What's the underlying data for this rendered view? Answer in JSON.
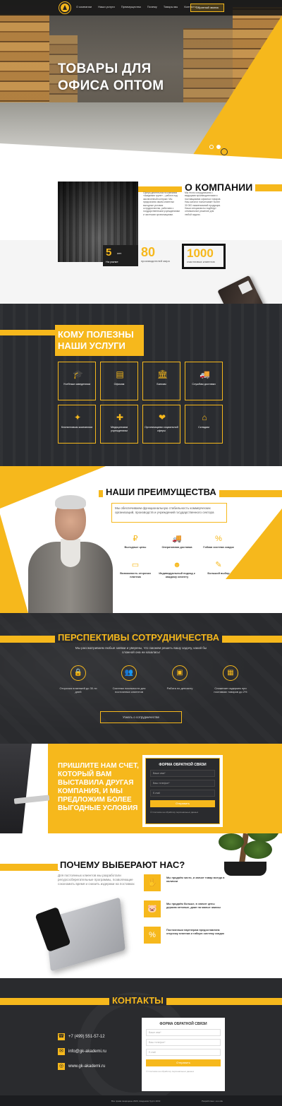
{
  "nav": {
    "items": [
      "О компании",
      "Наши услуги",
      "Преимущества",
      "Почему",
      "Товары мы",
      "Контакты"
    ],
    "cta": "Обратный звонок"
  },
  "hero": {
    "title_line1": "ТОВАРЫ ДЛЯ",
    "title_line2": "ОФИСА ОПТОМ"
  },
  "about": {
    "title": "О КОМПАНИИ",
    "col1": "Сфера деятельности компании «Академия групп» – работа под заключенный контракт. Мы предлагаем своим клиентам выгодные условия сотрудничества, работаем с государственными учреждениями и частными организациями.",
    "col2": "Мы тесно сотрудничаем с ведущими производителями и поставщиками офисных товаров. Наш каталог насчитывает более 30 000 наименований продукции. Наши специалисты подберут оптимальное решение для любой задачи.",
    "stat1_value": "5",
    "stat1_unit": "лет",
    "stat1_label": "На рынке",
    "stat2_value": "80",
    "stat2_label": "производителей мира",
    "stat3_value": "1000",
    "stat3_label": "счастливых клиентов"
  },
  "services": {
    "title_line1": "КОМУ ПОЛЕЗНЫ",
    "title_line2": "НАШИ УСЛУГИ",
    "items": [
      {
        "label": "Учебным заведениям",
        "icon": "graduation-cap-icon"
      },
      {
        "label": "Офисам",
        "icon": "folder-icon"
      },
      {
        "label": "Банкам",
        "icon": "bank-icon"
      },
      {
        "label": "Службам доставки",
        "icon": "truck-icon"
      },
      {
        "label": "Клининговым компаниям",
        "icon": "cleaning-icon"
      },
      {
        "label": "Медицинским учреждениям",
        "icon": "medkit-icon"
      },
      {
        "label": "Организациям социальной сферы",
        "icon": "hands-icon"
      },
      {
        "label": "Складам",
        "icon": "warehouse-icon"
      }
    ]
  },
  "advantages": {
    "title": "НАШИ ПРЕИМУЩЕСТВА",
    "desc": "Мы обеспечиваем функциональную стабильность коммерческих организаций, производств и учреждений государственного сектора",
    "items": [
      {
        "label": "Выгодные цены",
        "icon": "ruble-icon"
      },
      {
        "label": "Оперативная доставка",
        "icon": "truck-icon"
      },
      {
        "label": "Гибкая система скидок",
        "icon": "percent-icon"
      },
      {
        "label": "Возможность отсрочки платежа",
        "icon": "card-icon"
      },
      {
        "label": "Индивидуальный подход к каждому клиенту",
        "icon": "person-icon"
      },
      {
        "label": "Большой выбор",
        "icon": "office-supplies-icon"
      }
    ]
  },
  "perspectives": {
    "title": "ПЕРСПЕКТИВЫ СОТРУДНИЧЕСТВА",
    "text": "Мы рассматриваем любые заявки и уверены, что сможем решить вашу задачу, какой бы сложной она ни казалась!",
    "items": [
      {
        "label": "Отсрочка платежей до 30-ти дней",
        "icon": "lock-icon"
      },
      {
        "label": "Система лояльности для постоянных клиентов",
        "icon": "people-icon"
      },
      {
        "label": "Работа по депозиту",
        "icon": "safe-icon"
      },
      {
        "label": "Снижение издержек при поставках товаров до 2%",
        "icon": "boxes-icon"
      }
    ],
    "button": "Узнать о сотрудничестве"
  },
  "quote": {
    "title": "ПРИШЛИТЕ НАМ СЧЕТ, КОТОРЫЙ ВАМ ВЫСТАВИЛА ДРУГАЯ КОМПАНИЯ, И МЫ ПРЕДЛОЖИМ БОЛЕЕ ВЫГОДНЫЕ УСЛОВИЯ",
    "form": {
      "heading": "ФОРМА ОБРАТНОЙ СВЯЗИ",
      "name_placeholder": "Ваше имя*",
      "phone_placeholder": "Ваш телефон*",
      "email_placeholder": "E-mail",
      "submit": "Отправить",
      "consent": "Согласие на обработку персональных данных"
    }
  },
  "why": {
    "title": "ПОЧЕМУ ВЫБЕРАЮТ НАС?",
    "desc": "Для постоянных клиентов мы разработали ресурсосберегательные программы, позволяющие сэкономить время и снизить издержки на поставках",
    "items": [
      {
        "label": "Мы продаём чисто, и значит товар всегда в наличии",
        "icon": "hand-icon"
      },
      {
        "label": "Мы продаём больше, в значит цены держим оптовые, даже на малые заказы",
        "icon": "piggy-bank-icon"
      },
      {
        "label": "Постоянным партнерам предоставляем отсрочку платежа и гибкую систему скидок",
        "icon": "discount-icon"
      }
    ]
  },
  "contacts": {
    "title": "КОНТАКТЫ",
    "phone": "+7 (499) 551-57-12",
    "email": "info@gk-akademi.ru",
    "site": "www.gk-akademi.ru",
    "form": {
      "heading": "ФОРМА ОБРАТНОЙ СВЯЗИ",
      "name_placeholder": "Ваше имя*",
      "phone_placeholder": "Ваш телефон*",
      "email_placeholder": "E-mail",
      "submit": "Отправить",
      "consent": "Согласие на обработку персональных данных"
    }
  },
  "footer": {
    "copyright": "Все права защищены 2020, Академия Групп 2019",
    "developer": "Разработано: ooo.site"
  },
  "colors": {
    "accent": "#f6b81c",
    "dark": "#2a2b2e"
  }
}
